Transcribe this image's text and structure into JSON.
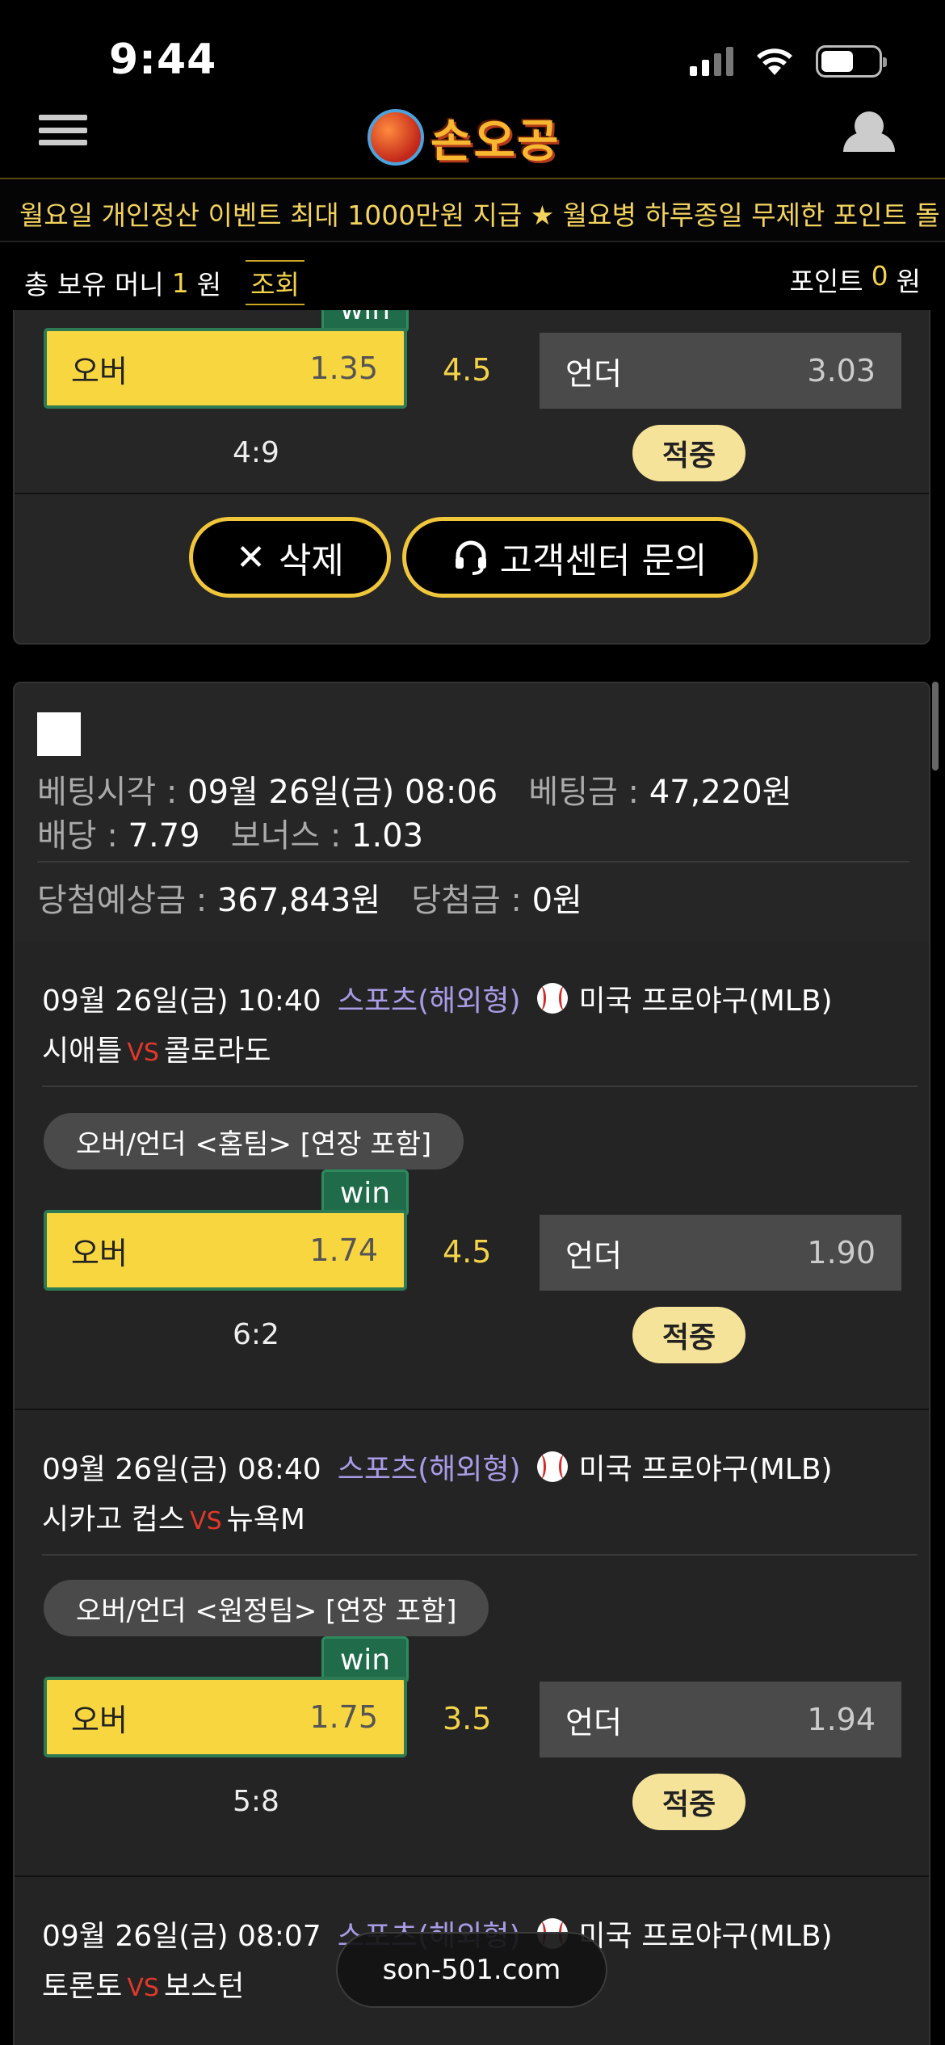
{
  "status_bar": {
    "time": "9:44"
  },
  "header": {
    "logo_text": "손오공"
  },
  "notice": {
    "text": "월요일 개인정산 이벤트 최대 1000만원 지급 ★ 월요병 하루종일 무제한 포인트 돌"
  },
  "account": {
    "money_label": "총 보유 머니",
    "money_value": "1",
    "money_unit": "원",
    "query_label": "조회",
    "point_label": "포인트",
    "point_value": "0",
    "point_unit": "원"
  },
  "card1": {
    "win_label": "win",
    "over_label": "오버",
    "over_odds": "1.35",
    "line": "4.5",
    "under_label": "언더",
    "under_odds": "3.03",
    "score": "4:9",
    "result": "적중",
    "delete_label": "삭제",
    "support_label": "고객센터 문의"
  },
  "card2": {
    "bet_time_label": "베팅시각 :",
    "bet_time": "09월 26일(금) 08:06",
    "bet_amount_label": "베팅금 :",
    "bet_amount": "47,220원",
    "odds_label": "배당 :",
    "odds": "7.79",
    "bonus_label": "보너스 :",
    "bonus": "1.03",
    "expected_label": "당첨예상금 :",
    "expected": "367,843원",
    "won_label": "당첨금 :",
    "won": "0원"
  },
  "games": [
    {
      "datetime": "09월 26일(금) 10:40",
      "category": "스포츠(해외형)",
      "league": "미국 프로야구(MLB)",
      "home": "시애틀",
      "vs": "VS",
      "away": "콜로라도",
      "market": "오버/언더 <홈팀> [연장 포함]",
      "win_label": "win",
      "over_label": "오버",
      "over_odds": "1.74",
      "line": "4.5",
      "under_label": "언더",
      "under_odds": "1.90",
      "score": "6:2",
      "result": "적중"
    },
    {
      "datetime": "09월 26일(금) 08:40",
      "category": "스포츠(해외형)",
      "league": "미국 프로야구(MLB)",
      "home": "시카고 컵스",
      "vs": "VS",
      "away": "뉴욕M",
      "market": "오버/언더 <원정팀> [연장 포함]",
      "win_label": "win",
      "over_label": "오버",
      "over_odds": "1.75",
      "line": "3.5",
      "under_label": "언더",
      "under_odds": "1.94",
      "score": "5:8",
      "result": "적중"
    },
    {
      "datetime": "09월 26일(금) 08:07",
      "category": "스포츠(해외형)",
      "league": "미국 프로야구(MLB)",
      "home": "토론토",
      "vs": "VS",
      "away": "보스턴"
    }
  ],
  "browser": {
    "url": "son-501.com"
  }
}
